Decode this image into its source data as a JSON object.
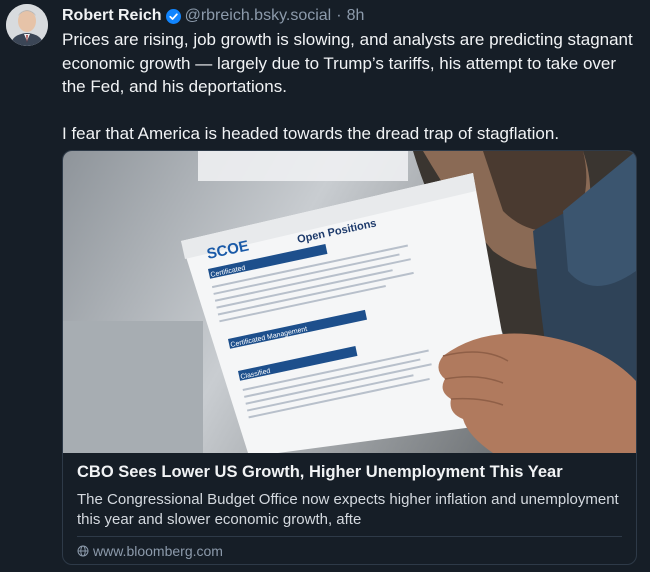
{
  "post": {
    "author_name": "Robert Reich",
    "handle": "@rbreich.bsky.social",
    "separator": "·",
    "time": "8h",
    "text_paragraphs": [
      "Prices are rising, job growth is slowing, and analysts are predicting stagnant economic growth — largely due to Trump’s tariffs, his attempt to take over the Fed, and his deportations.",
      "I fear that America is headed towards the dread trap of stagflation."
    ]
  },
  "link_card": {
    "image": {
      "logo_text": "SCOE",
      "header": "Open Positions",
      "sections": [
        "Certificated",
        "Certificated Management",
        "Classified"
      ]
    },
    "title": "CBO Sees Lower US Growth, Higher Unemployment This Year",
    "description": "The Congressional Budget Office now expects higher inflation and unemployment this year and slower economic growth, afte",
    "source": "www.bloomberg.com"
  },
  "colors": {
    "background": "#161e27",
    "verified_badge": "#1185fe",
    "muted_text": "#8c9aab"
  },
  "icons": {
    "verified": "verified-check-icon",
    "source": "globe-icon"
  }
}
